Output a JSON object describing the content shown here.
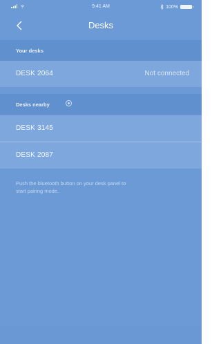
{
  "status_bar": {
    "time": "9:41 AM",
    "battery": "100%"
  },
  "nav": {
    "title": "Desks",
    "back_icon": "chevron-left-icon"
  },
  "your_desks": {
    "header": "Your desks",
    "items": [
      {
        "name": "DESK 2064",
        "status": "Not connected"
      }
    ]
  },
  "nearby": {
    "header": "Desks nearby",
    "loader_icon": "loading-icon",
    "items": [
      {
        "name": "DESK 3145"
      },
      {
        "name": "DESK 2087"
      }
    ]
  },
  "hint": {
    "line1": "Push the bluetooth button on your desk panel to",
    "line2": "start pairing mode."
  },
  "colors": {
    "background": "#6b9ad6",
    "row": "#7ea8dd",
    "section": "#6190cf"
  }
}
